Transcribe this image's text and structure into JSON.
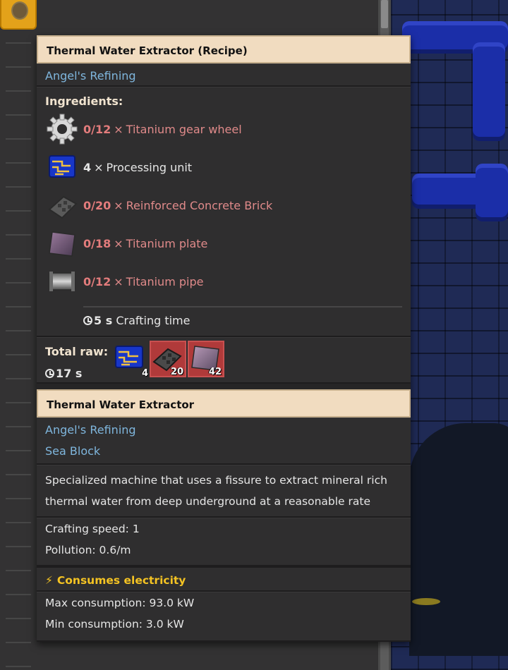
{
  "recipe": {
    "title": "Thermal Water Extractor (Recipe)",
    "mod": "Angel's Refining",
    "ingredients_label": "Ingredients:",
    "ingredients": [
      {
        "count": "0/12",
        "mult": "×",
        "name": "Titanium gear wheel",
        "icon": "gear-icon",
        "missing": true
      },
      {
        "count": "4",
        "mult": "×",
        "name": "Processing unit",
        "icon": "processing-unit-icon",
        "missing": false
      },
      {
        "count": "0/20",
        "mult": "×",
        "name": "Reinforced Concrete Brick",
        "icon": "concrete-brick-icon",
        "missing": true
      },
      {
        "count": "0/18",
        "mult": "×",
        "name": "Titanium plate",
        "icon": "titanium-plate-icon",
        "missing": true
      },
      {
        "count": "0/12",
        "mult": "×",
        "name": "Titanium pipe",
        "icon": "titanium-pipe-icon",
        "missing": true
      }
    ],
    "crafting_time_value": "5 s",
    "crafting_time_label": "Crafting time",
    "total_raw_label": "Total raw:",
    "total_raw_time": "17 s",
    "total_raw": [
      {
        "icon": "processing-unit-icon",
        "count": "4",
        "missing": false
      },
      {
        "icon": "concrete-brick-icon",
        "count": "20",
        "missing": true
      },
      {
        "icon": "titanium-plate-icon",
        "count": "42",
        "missing": true
      }
    ]
  },
  "entity": {
    "title": "Thermal Water Extractor",
    "mods": [
      "Angel's Refining",
      "Sea Block"
    ],
    "description_lines": [
      "Specialized machine that uses a fissure to extract mineral rich",
      "thermal water from deep underground at a reasonable rate"
    ],
    "crafting_speed": "Crafting speed: 1",
    "pollution": "Pollution: 0.6/m",
    "power_header": "Consumes electricity",
    "max_consumption": "Max consumption: 93.0 kW",
    "min_consumption": "Min consumption: 3.0 kW"
  },
  "colors": {
    "header_bg": "#f1dcc0",
    "mod_text": "#7fb6dd",
    "missing_text": "#e08a8a",
    "power_text": "#f4c323",
    "missing_slot": "#b03a3a"
  }
}
